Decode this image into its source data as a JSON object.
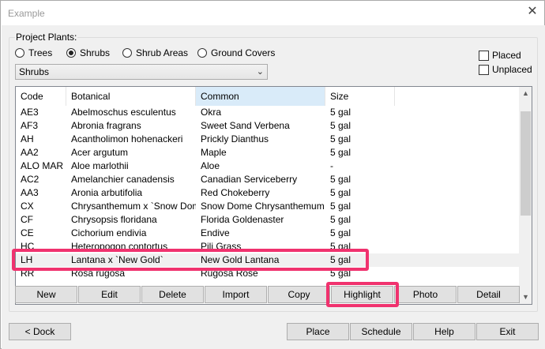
{
  "window": {
    "title": "Example",
    "close_glyph": "✕"
  },
  "group_label": "Project Plants:",
  "radios": [
    {
      "label": "Trees",
      "checked": false
    },
    {
      "label": "Shrubs",
      "checked": true
    },
    {
      "label": "Shrub Areas",
      "checked": false
    },
    {
      "label": "Ground Covers",
      "checked": false
    }
  ],
  "dropdown": {
    "value": "Shrubs",
    "chevron": "⌄"
  },
  "checkboxes": [
    {
      "label": "Placed",
      "checked": false
    },
    {
      "label": "Unplaced",
      "checked": false
    }
  ],
  "table": {
    "headers": [
      "Code",
      "Botanical",
      "Common",
      "Size"
    ],
    "active_header": "Common",
    "rows": [
      [
        "AE3",
        "Abelmoschus esculentus",
        "Okra",
        "5 gal"
      ],
      [
        "AF3",
        "Abronia fragrans",
        "Sweet Sand Verbena",
        "5 gal"
      ],
      [
        "AH",
        "Acantholimon hohenackeri",
        "Prickly Dianthus",
        "5 gal"
      ],
      [
        "AA2",
        "Acer argutum",
        "Maple",
        "5 gal"
      ],
      [
        "ALO MAR",
        "Aloe marlothii",
        "Aloe",
        "-"
      ],
      [
        "AC2",
        "Amelanchier canadensis",
        "Canadian Serviceberry",
        "5 gal"
      ],
      [
        "AA3",
        "Aronia arbutifolia",
        "Red Chokeberry",
        "5 gal"
      ],
      [
        "CX",
        "Chrysanthemum x `Snow Dome`",
        "Snow Dome Chrysanthemum",
        "5 gal"
      ],
      [
        "CF",
        "Chrysopsis floridana",
        "Florida Goldenaster",
        "5 gal"
      ],
      [
        "CE",
        "Cichorium endivia",
        "Endive",
        "5 gal"
      ],
      [
        "HC",
        "Heteropogon contortus",
        "Pili Grass",
        "5 gal"
      ],
      [
        "LH",
        "Lantana x `New Gold`",
        "New Gold Lantana",
        "5 gal"
      ],
      [
        "RR",
        "Rosa rugosa",
        "Rugosa Rose",
        "5 gal"
      ]
    ],
    "selected_code": "LH",
    "scroll_up": "▲",
    "scroll_down": "▼"
  },
  "action_buttons": [
    "New",
    "Edit",
    "Delete",
    "Import",
    "Copy",
    "Highlight",
    "Photo",
    "Detail"
  ],
  "bottom_buttons": {
    "dock": "< Dock",
    "place": "Place",
    "schedule": "Schedule",
    "help": "Help",
    "exit": "Exit"
  },
  "highlight_color": "#f0326e"
}
